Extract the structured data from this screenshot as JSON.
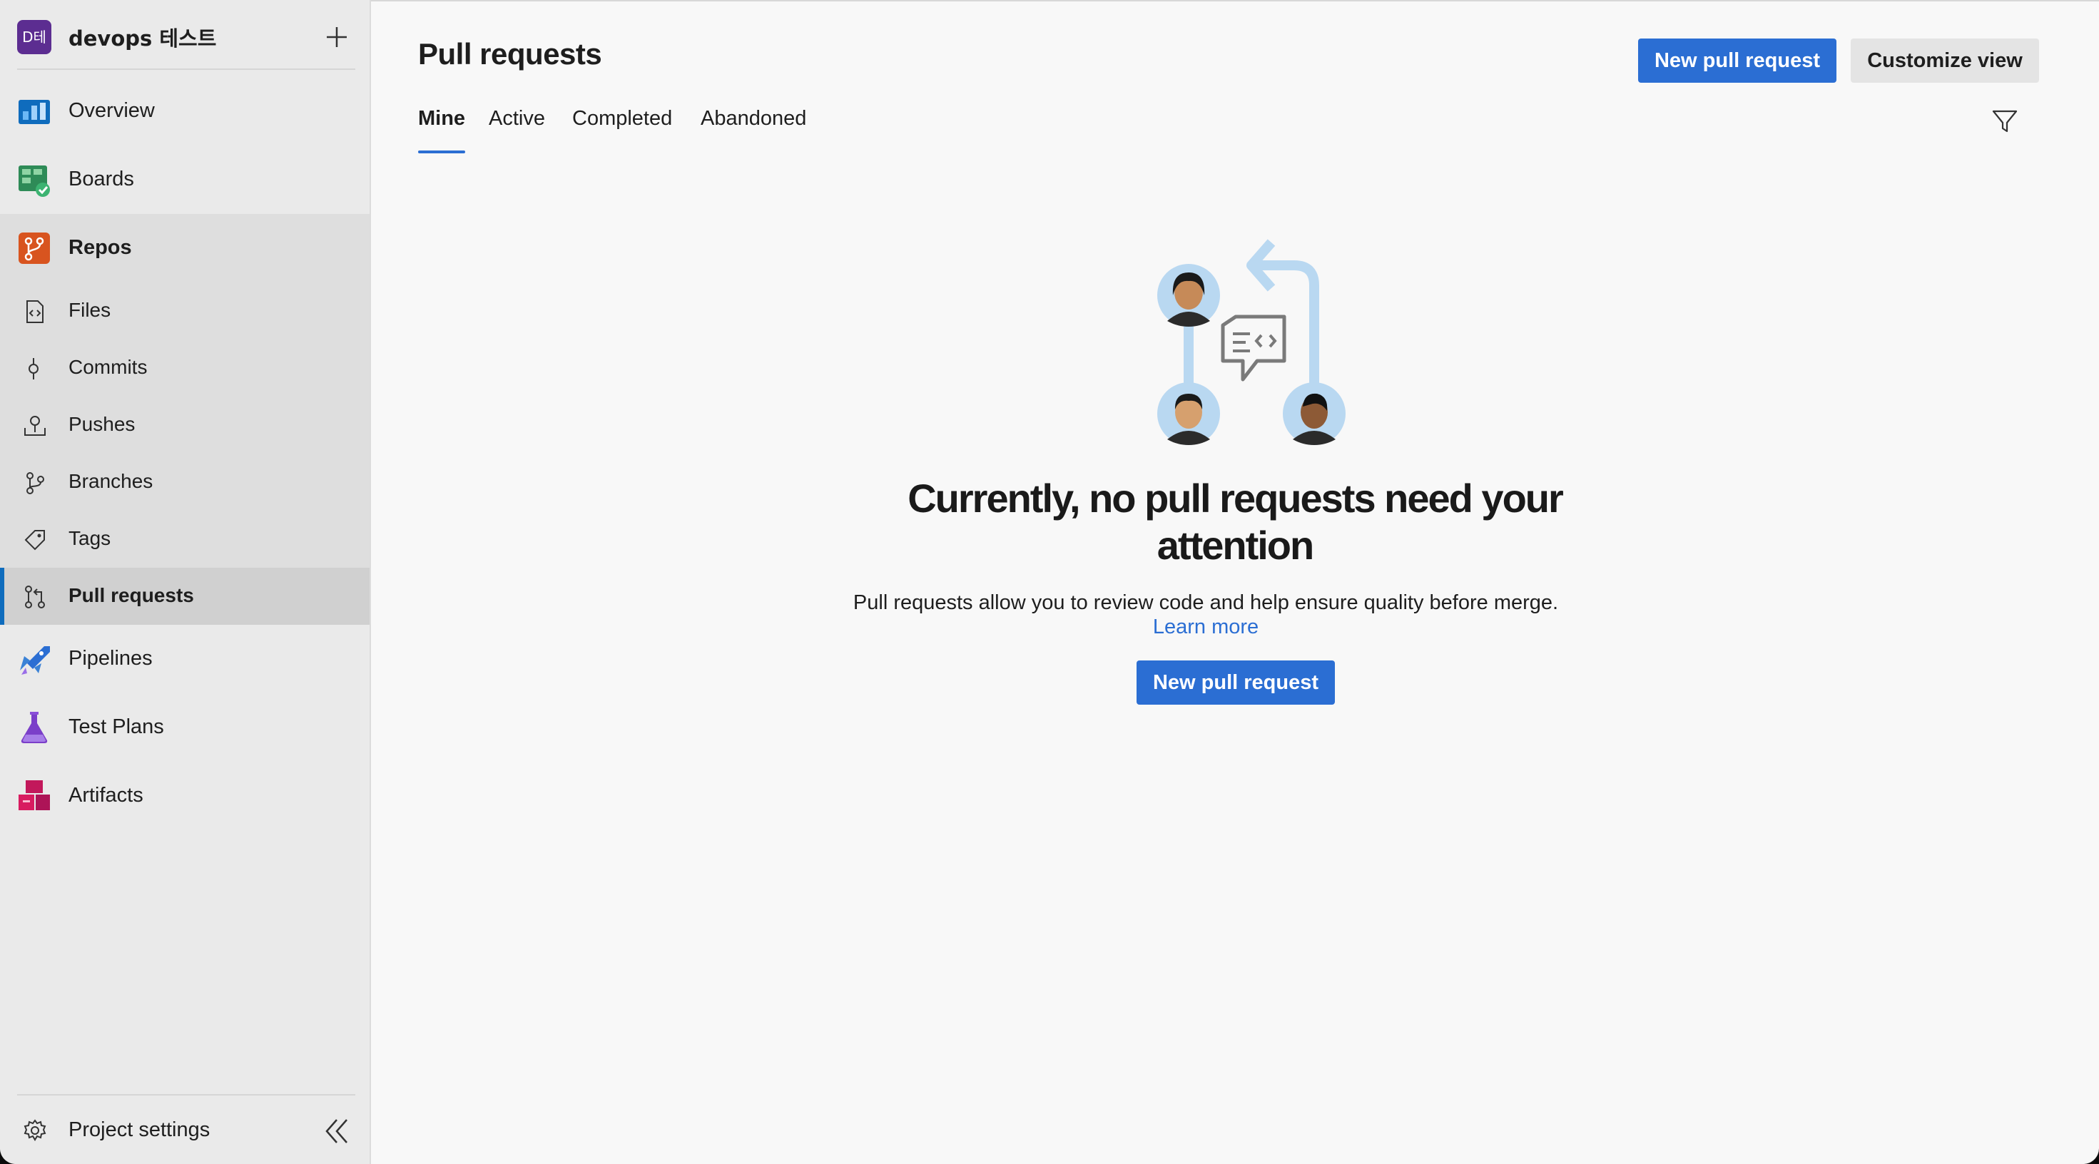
{
  "project": {
    "avatar_text": "D테",
    "name": "devops 테스트"
  },
  "nav": {
    "overview": "Overview",
    "boards": "Boards",
    "repos": "Repos",
    "pipelines": "Pipelines",
    "test_plans": "Test Plans",
    "artifacts": "Artifacts"
  },
  "repos_sub": {
    "files": "Files",
    "commits": "Commits",
    "pushes": "Pushes",
    "branches": "Branches",
    "tags": "Tags",
    "pull_requests": "Pull requests"
  },
  "settings": {
    "label": "Project settings"
  },
  "header": {
    "title": "Pull requests",
    "new_pr_label": "New pull request",
    "customize_label": "Customize view"
  },
  "tabs": {
    "mine": "Mine",
    "active": "Active",
    "completed": "Completed",
    "abandoned": "Abandoned"
  },
  "empty_state": {
    "title_line1": "Currently, no pull requests need your",
    "title_line2": "attention",
    "description": "Pull requests allow you to review code and help ensure quality before merge.",
    "learn_more": "Learn more",
    "button_label": "New pull request"
  },
  "colors": {
    "accent": "#2b6ed3",
    "sidebar_bg": "#eaeaea",
    "main_bg": "#f8f8f8",
    "project_avatar": "#5c2d91"
  },
  "icons": {
    "plus": "plus-icon",
    "overview": "overview-icon",
    "boards": "boards-icon",
    "repos": "repos-icon",
    "files": "file-code-icon",
    "commits": "commit-icon",
    "pushes": "push-icon",
    "branches": "branch-icon",
    "tags": "tag-icon",
    "pull_requests": "pull-request-icon",
    "pipelines": "pipelines-icon",
    "test_plans": "test-plans-icon",
    "artifacts": "artifacts-icon",
    "settings": "gear-icon",
    "collapse": "double-chevron-left-icon",
    "filter": "filter-icon"
  }
}
